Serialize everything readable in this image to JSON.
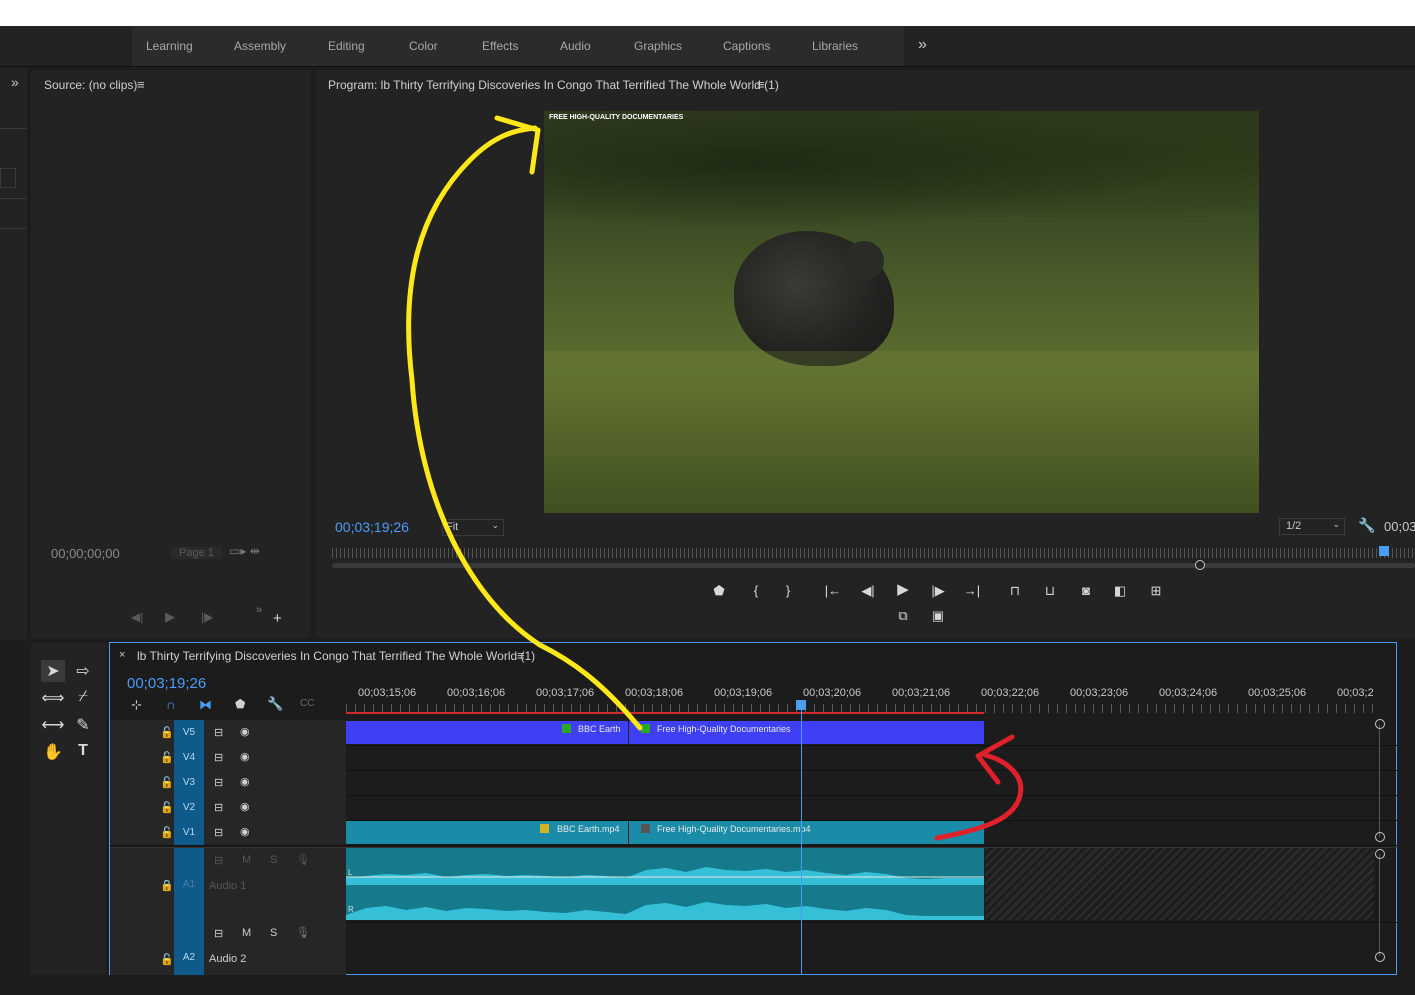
{
  "workspaces": {
    "tabs": [
      "Learning",
      "Assembly",
      "Editing",
      "Color",
      "Effects",
      "Audio",
      "Graphics",
      "Captions",
      "Libraries"
    ],
    "more_icon": "»"
  },
  "source_panel": {
    "title": "Source: (no clips)",
    "timecode": "00;00;00;00",
    "page": "Page 1"
  },
  "program_panel": {
    "title": "Program: lb Thirty Terrifying Discoveries In Congo That Terrified The Whole World (1)",
    "timecode": "00;03;19;26",
    "fit": "Fit",
    "resolution": "1/2",
    "end_timecode": "00;03",
    "watermark": "FREE HIGH-QUALITY DOCUMENTARIES"
  },
  "timeline": {
    "title": "lb Thirty Terrifying Discoveries In Congo That Terrified The Whole World (1)",
    "timecode": "00;03;19;26",
    "ruler": [
      "00;03;15;06",
      "00;03;16;06",
      "00;03;17;06",
      "00;03;18;06",
      "00;03;19;06",
      "00;03;20;06",
      "00;03;21;06",
      "00;03;22;06",
      "00;03;23;06",
      "00;03;24;06",
      "00;03;25;06",
      "00;03;2"
    ],
    "tracks": [
      {
        "name": "V5"
      },
      {
        "name": "V4"
      },
      {
        "name": "V3"
      },
      {
        "name": "V2"
      },
      {
        "name": "V1"
      }
    ],
    "audio_tracks": [
      {
        "name": "A1",
        "label": "Audio 1"
      },
      {
        "name": "A2",
        "label": "Audio 2"
      }
    ],
    "clips": {
      "v5_a": "BBC Earth",
      "v5_b": "Free High-Quality Documentaries",
      "v1_a": "BBC Earth.mp4",
      "v1_b": "Free High-Quality Documentaries.mp4"
    },
    "audio_channel_labels": [
      "L",
      "R"
    ],
    "m_label": "M",
    "s_label": "S"
  },
  "colors": {
    "accent": "#4b9cf5",
    "v5_clip": "#3f3ff5",
    "v1_clip": "#1a8ca8",
    "annotation_yellow": "#ffe81a",
    "annotation_red": "#e0202a"
  }
}
